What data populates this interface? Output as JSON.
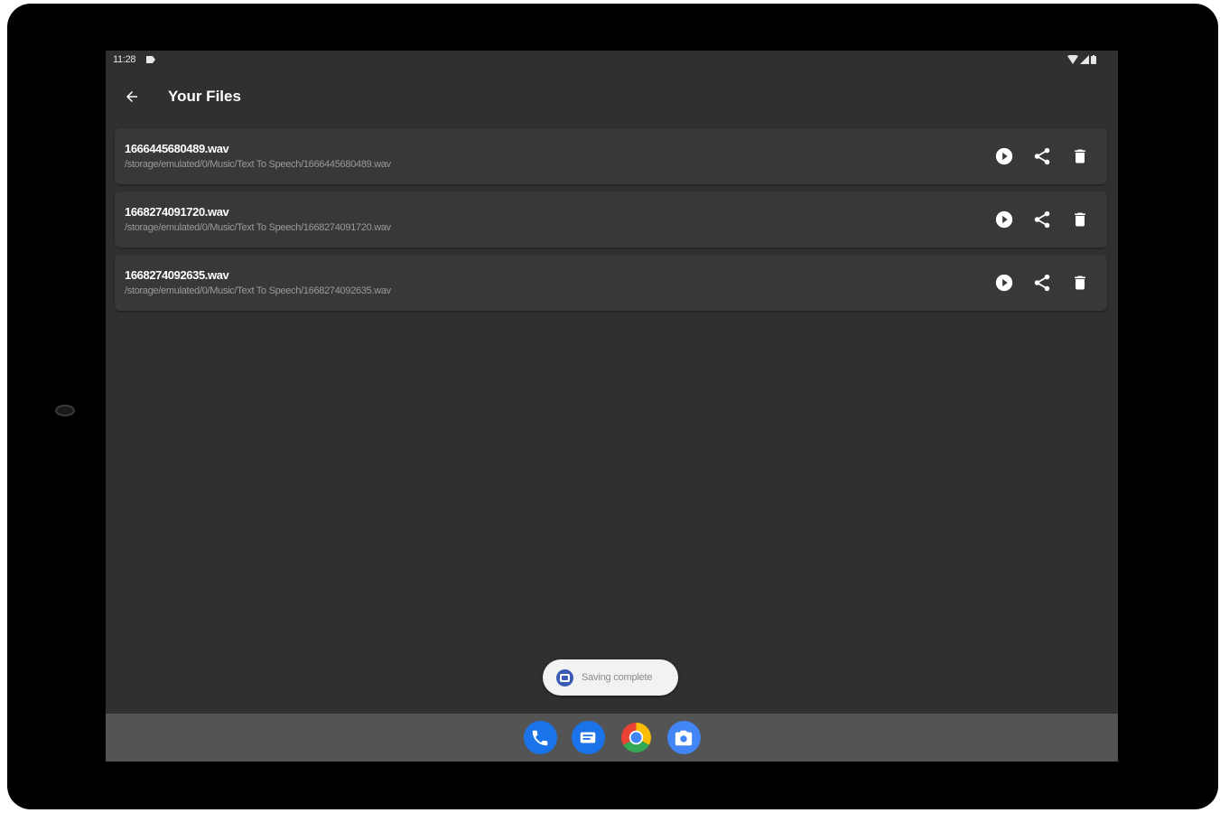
{
  "status_bar": {
    "time": "11:28"
  },
  "app_bar": {
    "title": "Your Files"
  },
  "files": [
    {
      "name": "1666445680489.wav",
      "path": "/storage/emulated/0/Music/Text To Speech/1666445680489.wav"
    },
    {
      "name": "1668274091720.wav",
      "path": "/storage/emulated/0/Music/Text To Speech/1668274091720.wav"
    },
    {
      "name": "1668274092635.wav",
      "path": "/storage/emulated/0/Music/Text To Speech/1668274092635.wav"
    }
  ],
  "file_actions": [
    "play-icon",
    "share-icon",
    "delete-icon"
  ],
  "toast": {
    "text": "Saving complete"
  },
  "dock": {
    "apps": [
      "phone",
      "messages",
      "chrome",
      "camera"
    ]
  },
  "colors": {
    "screen_bg": "#303030",
    "card_bg": "#383838",
    "dock_bg": "#545454",
    "toast_bg": "#f2f2f2",
    "accent_blue": "#1a73e8"
  }
}
